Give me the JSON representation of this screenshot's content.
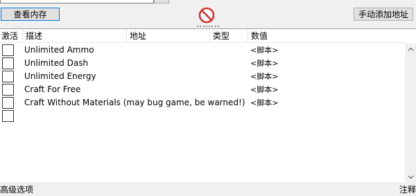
{
  "toolbar": {
    "view_memory_label": "查看内存",
    "add_address_label": "手动添加地址",
    "no_icon": "no-entry-icon"
  },
  "table": {
    "headers": {
      "active": "激活",
      "description": "描述",
      "address": "地址",
      "type": "类型",
      "value": "数值"
    },
    "rows": [
      {
        "description": "Unlimited Ammo",
        "value": "<脚本>"
      },
      {
        "description": "Unlimited Dash",
        "value": "<脚本>"
      },
      {
        "description": "Unlimited Energy",
        "value": "<脚本>"
      },
      {
        "description": "Craft For Free",
        "value": "<脚本>"
      },
      {
        "description": "Craft Without Materials (may bug game, be warned!)",
        "value": "<脚本>"
      },
      {
        "description": "",
        "value": ""
      }
    ]
  },
  "bottom": {
    "advanced_options": "高级选项",
    "notes": "注释"
  }
}
